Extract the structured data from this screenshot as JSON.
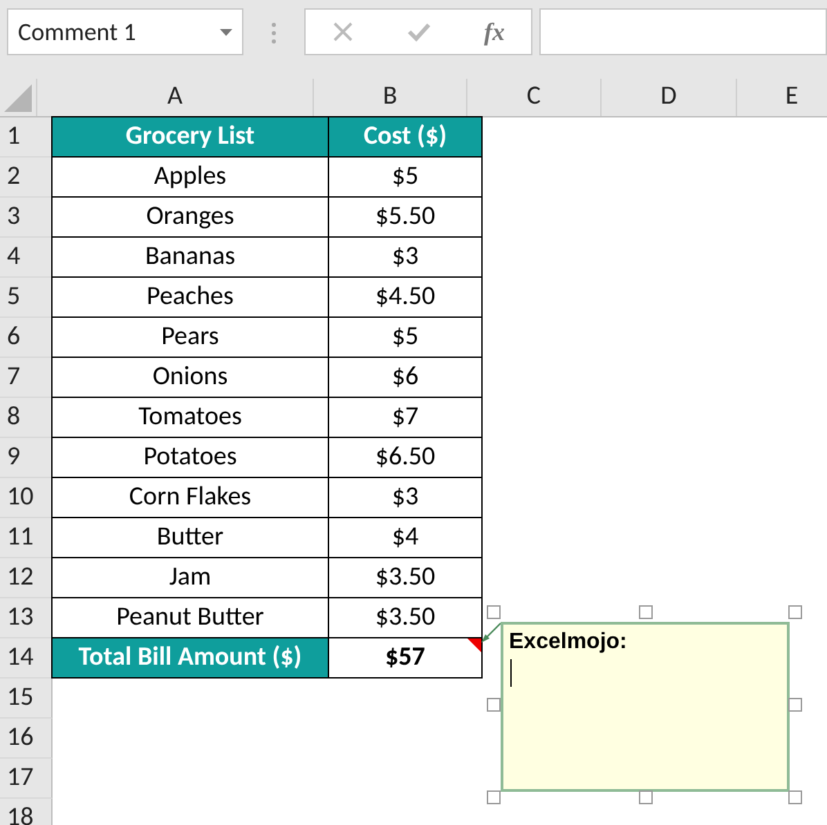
{
  "name_box": {
    "value": "Comment 1"
  },
  "formula_bar": {
    "function_label": "fx"
  },
  "columns": [
    "A",
    "B",
    "C",
    "D",
    "E"
  ],
  "rows": [
    {
      "number": "1",
      "kind": "header",
      "cells": [
        "Grocery List",
        "Cost ($)"
      ]
    },
    {
      "number": "2",
      "kind": "item",
      "cells": [
        "Apples",
        "$5"
      ]
    },
    {
      "number": "3",
      "kind": "item",
      "cells": [
        "Oranges",
        "$5.50"
      ]
    },
    {
      "number": "4",
      "kind": "item",
      "cells": [
        "Bananas",
        "$3"
      ]
    },
    {
      "number": "5",
      "kind": "item",
      "cells": [
        "Peaches",
        "$4.50"
      ]
    },
    {
      "number": "6",
      "kind": "item",
      "cells": [
        "Pears",
        "$5"
      ]
    },
    {
      "number": "7",
      "kind": "item",
      "cells": [
        "Onions",
        "$6"
      ]
    },
    {
      "number": "8",
      "kind": "item",
      "cells": [
        "Tomatoes",
        "$7"
      ]
    },
    {
      "number": "9",
      "kind": "item",
      "cells": [
        "Potatoes",
        "$6.50"
      ]
    },
    {
      "number": "10",
      "kind": "item",
      "cells": [
        "Corn Flakes",
        "$3"
      ]
    },
    {
      "number": "11",
      "kind": "item",
      "cells": [
        "Butter",
        "$4"
      ]
    },
    {
      "number": "12",
      "kind": "item",
      "cells": [
        "Jam",
        "$3.50"
      ]
    },
    {
      "number": "13",
      "kind": "item",
      "cells": [
        "Peanut Butter",
        "$3.50"
      ]
    },
    {
      "number": "14",
      "kind": "total",
      "cells": [
        "Total Bill Amount ($)",
        "$57"
      ],
      "has_comment": true
    },
    {
      "number": "15"
    },
    {
      "number": "16"
    },
    {
      "number": "17"
    },
    {
      "number": "18"
    }
  ],
  "comment": {
    "author": "Excelmojo:"
  }
}
